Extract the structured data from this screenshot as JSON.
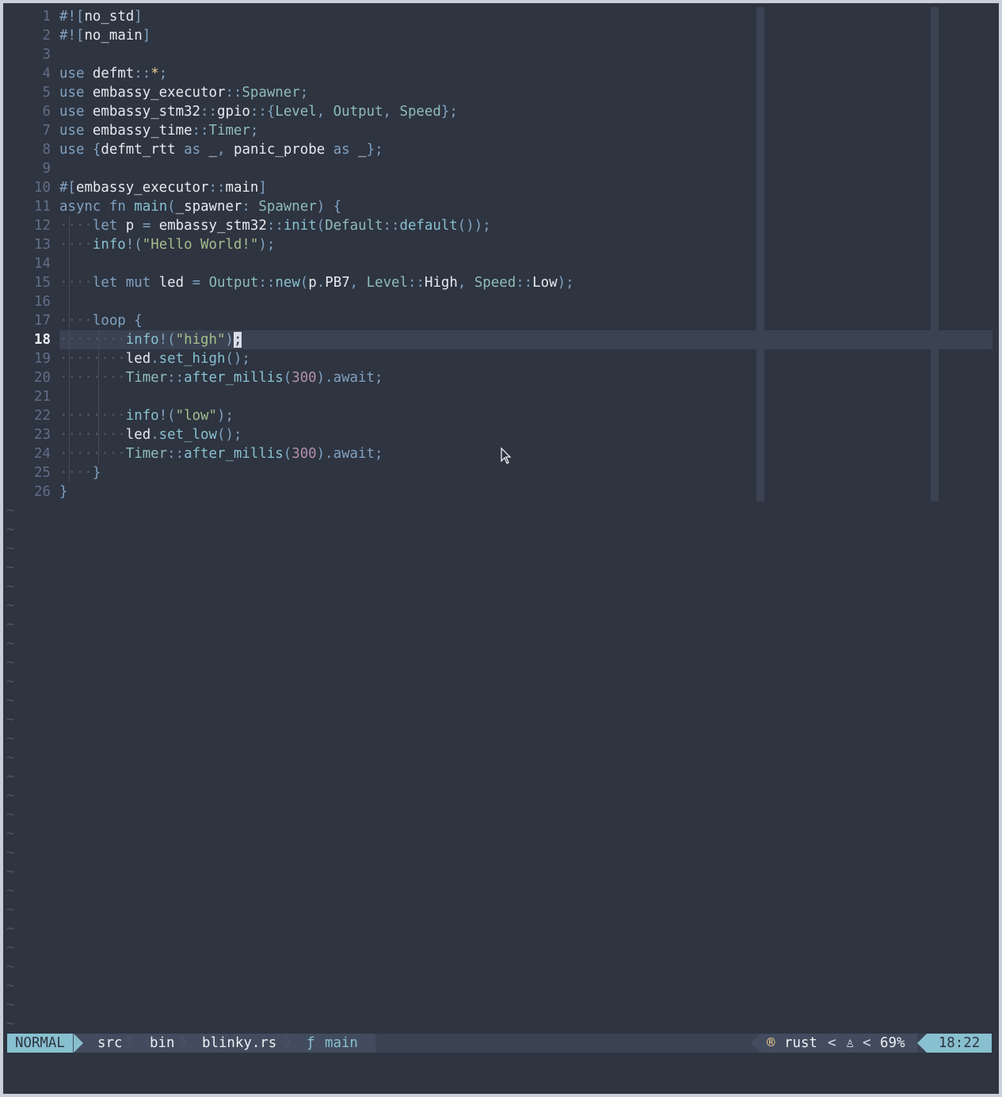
{
  "editor": {
    "lines": [
      {
        "n": "1",
        "t": "#![no_std]"
      },
      {
        "n": "2",
        "t": "#![no_main]"
      },
      {
        "n": "3",
        "t": ""
      },
      {
        "n": "4",
        "t": "use defmt::*;"
      },
      {
        "n": "5",
        "t": "use embassy_executor::Spawner;"
      },
      {
        "n": "6",
        "t": "use embassy_stm32::gpio::{Level, Output, Speed};"
      },
      {
        "n": "7",
        "t": "use embassy_time::Timer;"
      },
      {
        "n": "8",
        "t": "use {defmt_rtt as _, panic_probe as _};"
      },
      {
        "n": "9",
        "t": ""
      },
      {
        "n": "10",
        "t": "#[embassy_executor::main]"
      },
      {
        "n": "11",
        "t": "async fn main(_spawner: Spawner) {"
      },
      {
        "n": "12",
        "t": "    let p = embassy_stm32::init(Default::default());"
      },
      {
        "n": "13",
        "t": "    info!(\"Hello World!\");"
      },
      {
        "n": "14",
        "t": ""
      },
      {
        "n": "15",
        "t": "    let mut led = Output::new(p.PB7, Level::High, Speed::Low);"
      },
      {
        "n": "16",
        "t": ""
      },
      {
        "n": "17",
        "t": "    loop {"
      },
      {
        "n": "18",
        "t": "        info!(\"high\");"
      },
      {
        "n": "19",
        "t": "        led.set_high();"
      },
      {
        "n": "20",
        "t": "        Timer::after_millis(300).await;"
      },
      {
        "n": "21",
        "t": ""
      },
      {
        "n": "22",
        "t": "        info!(\"low\");"
      },
      {
        "n": "23",
        "t": "        led.set_low();"
      },
      {
        "n": "24",
        "t": "        Timer::after_millis(300).await;"
      },
      {
        "n": "25",
        "t": "    }"
      },
      {
        "n": "26",
        "t": "}"
      }
    ],
    "current_line": "18",
    "tilde": "~",
    "whitespace_marker": "·"
  },
  "statusline": {
    "mode": "NORMAL",
    "crumbs": [
      "src",
      "bin",
      "blinky.rs"
    ],
    "crumb_sep": "〉",
    "symbol_icon": "ƒ",
    "symbol": "main",
    "filetype_icon": "rust-icon",
    "filetype_glyph": "®",
    "filetype": "rust",
    "right_sep": "<",
    "os_icon": "linux-icon",
    "os_glyph": "♙",
    "percent": "69%",
    "position": "18:22"
  },
  "colors": {
    "background": "#2e3440",
    "accent": "#88c0d0",
    "keyword": "#81a1c1",
    "string": "#a3be8c",
    "number": "#b48ead"
  }
}
